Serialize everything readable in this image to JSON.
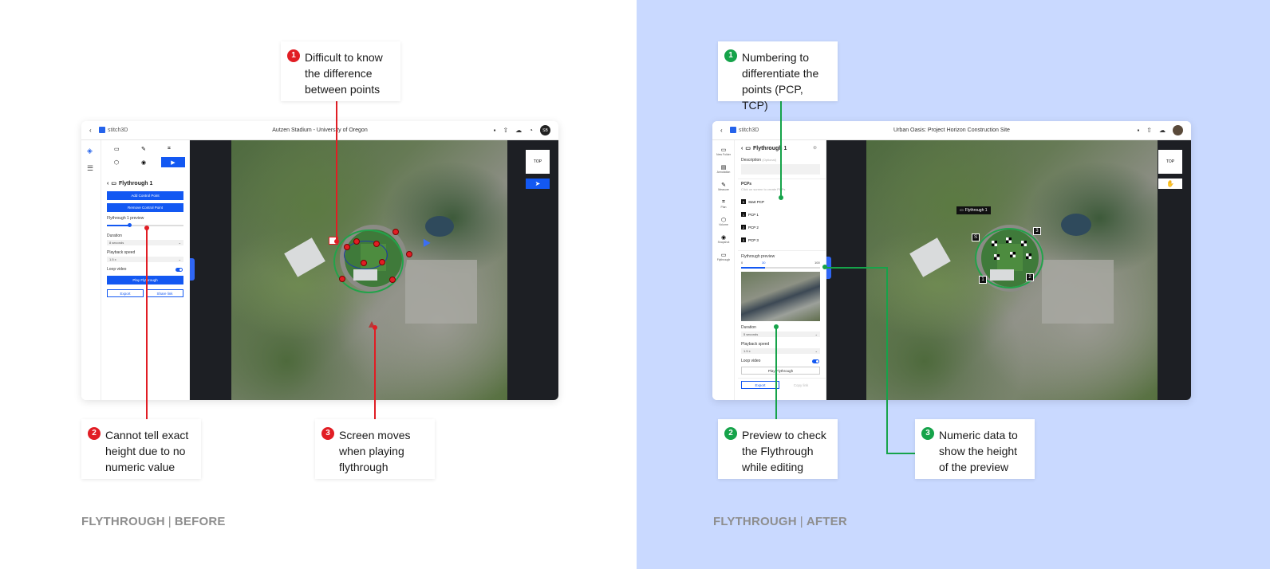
{
  "before": {
    "footer": {
      "section": "FLYTHROUGH",
      "separator": "|",
      "state": "BEFORE"
    },
    "app": {
      "brand": "stitch3D",
      "title": "Autzen Stadium - University of Oregon",
      "avatar_initials": "SB",
      "panel": {
        "title": "Flythrough 1",
        "add_point": "Add Control Point",
        "remove_point": "Remove Control Point",
        "preview_label": "Flythrough 1 preview",
        "duration_label": "Duration",
        "duration_value": "8 seconds",
        "speed_label": "Playback speed",
        "speed_value": "1.5 x",
        "loop_label": "Loop video",
        "play": "Play Flythrough",
        "export": "Export",
        "share": "Share link"
      },
      "map": {
        "view_label": "TOP"
      }
    },
    "callouts": [
      {
        "n": "1",
        "text": "Difficult to know the difference between points"
      },
      {
        "n": "2",
        "text": "Cannot tell exact height due to no numeric value"
      },
      {
        "n": "3",
        "text": "Screen moves when playing flythrough"
      }
    ]
  },
  "after": {
    "footer": {
      "section": "FLYTHROUGH",
      "separator": "|",
      "state": "AFTER"
    },
    "app": {
      "brand": "stitch3D",
      "title": "Urban Oasis: Project Horizon Construction Site",
      "rail": [
        "New Folder",
        "Annotation",
        "Measure",
        "Plan",
        "Volume",
        "Snapshot",
        "Flythrough"
      ],
      "panel": {
        "title": "Flythrough 1",
        "desc_label": "Description",
        "desc_optional": "(Optional)",
        "pcps_label": "PCPs",
        "pcps_hint": "Click on screen to create PCPs",
        "points": [
          "Start PCP",
          "PCP 1",
          "PCP 2",
          "PCP 3"
        ],
        "preview_label": "Flythrough preview",
        "scale_min": "0",
        "scale_mid": "30",
        "scale_max": "100",
        "duration_label": "Duration",
        "duration_value": "5 seconds",
        "speed_label": "Playback speed",
        "speed_value": "1.5 x",
        "loop_label": "Loop video",
        "play": "Play Flythrough",
        "export": "Export",
        "copy": "Copy link"
      },
      "map": {
        "view_label": "TOP",
        "flythrough_tag": "Flythrough 1",
        "markers": [
          "S",
          "1",
          "2",
          "3"
        ]
      }
    },
    "callouts": [
      {
        "n": "1",
        "text": "Numbering to differentiate the points (PCP, TCP)"
      },
      {
        "n": "2",
        "text": "Preview to check the Flythrough while editing"
      },
      {
        "n": "3",
        "text": "Numeric data to show the height of the preview"
      }
    ]
  }
}
